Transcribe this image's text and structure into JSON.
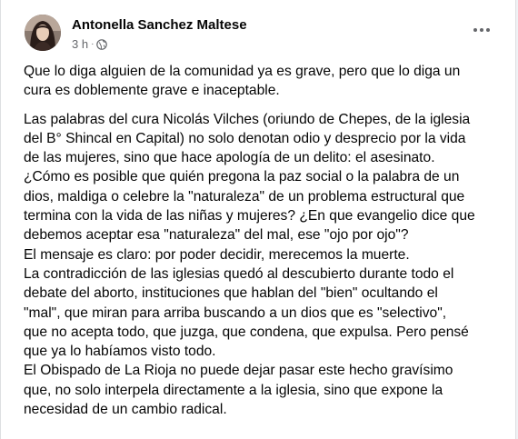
{
  "post": {
    "author": "Antonella Sanchez Maltese",
    "time": "3 h",
    "separator": "·",
    "privacy_icon": "globe-icon",
    "more_icon": "more-options-icon",
    "paragraph1": "Que lo diga alguien de la comunidad ya es grave, pero que lo diga un\ncura es doblemente grave e inaceptable.",
    "paragraph2": "Las palabras del cura Nicolás Vilches (oriundo de Chepes, de la iglesia\ndel B° Shincal en Capital) no solo denotan odio y desprecio por la vida\nde las mujeres, sino que hace apología de un delito: el asesinato.\n¿Cómo es posible que quién pregona la paz social o la palabra de un\ndios, maldiga o celebre la \"naturaleza\" de un problema estructural que\ntermina con la vida de las niñas y mujeres? ¿En que evangelio dice que\ndebemos aceptar esa \"naturaleza\" del mal, ese \"ojo por ojo\"?\nEl mensaje es claro: por poder decidir, merecemos la muerte.\nLa contradicción de las iglesias quedó al descubierto durante todo el\ndebate del aborto, instituciones que hablan del \"bien\" ocultando el\n\"mal\", que miran para arriba buscando a un dios que es \"selectivo\",\nque no acepta todo, que juzga, que condena, que expulsa. Pero pensé\nque ya lo habíamos visto todo.\nEl Obispado de La Rioja no puede dejar pasar este hecho gravísimo\nque, no solo interpela directamente a la iglesia, sino que expone la\nnecesidad de un cambio radical."
  }
}
